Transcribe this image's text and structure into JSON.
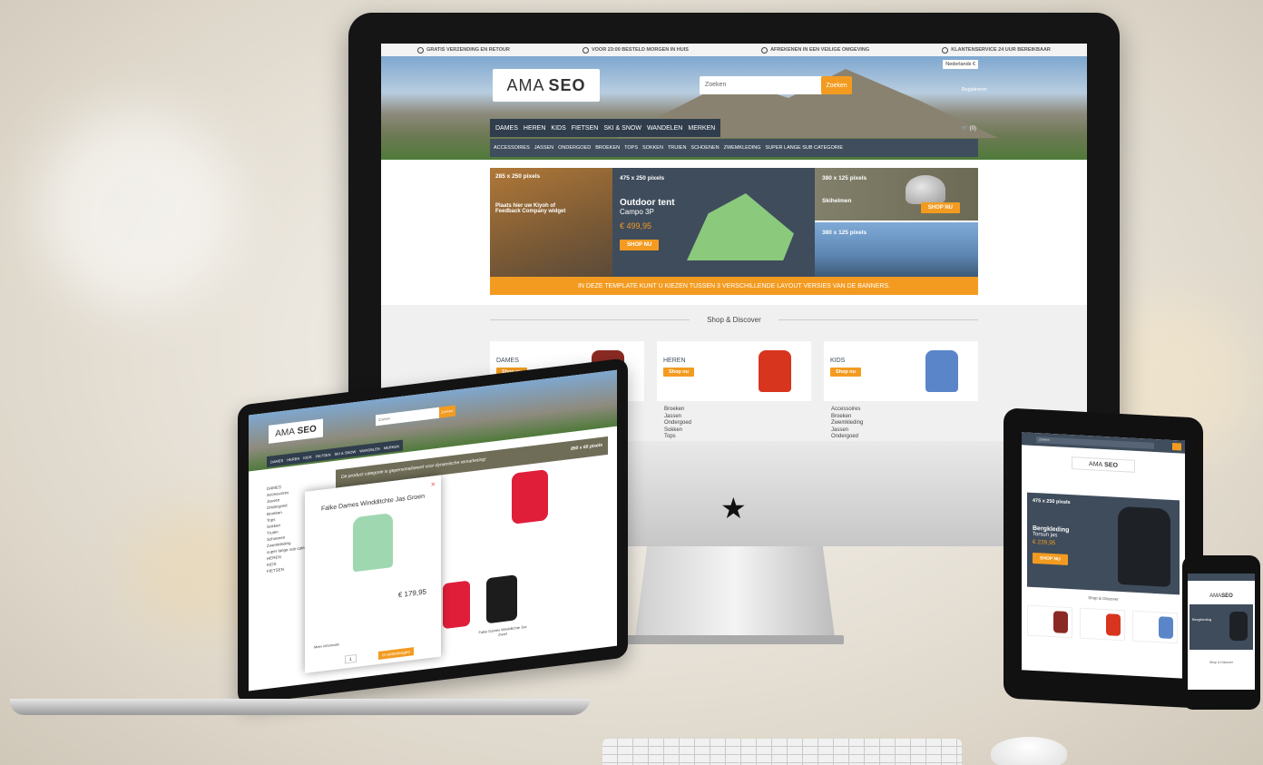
{
  "usp": [
    "GRATIS VERZENDING EN RETOUR",
    "VOOR 23:00 BESTELD MORGEN IN HUIS",
    "AFREKENEN IN EEN VEILIGE OMGEVING",
    "KLANTENSERVICE 24 UUR BEREIKBAAR"
  ],
  "header": {
    "logo_light": "AMA",
    "logo_bold": "SEO",
    "search_placeholder": "Zoeken",
    "search_button": "Zoeken",
    "language": "Nederlands",
    "currency": "€",
    "register": "Registreren",
    "cart": "(0)"
  },
  "nav_main": [
    "DAMES",
    "HEREN",
    "KIDS",
    "FIETSEN",
    "SKI & SNOW",
    "WANDELEN",
    "MERKEN"
  ],
  "nav_sub": [
    "ACCESSOIRES",
    "JASSEN",
    "ONDERGOED",
    "BROEKEN",
    "TOPS",
    "SOKKEN",
    "TRUIEN",
    "SCHOENEN",
    "ZWEMKLEDING",
    "SUPER LANGE SUB CATEGORIE"
  ],
  "banners": {
    "b1_size": "285 x 250 pixels",
    "b1_text": "Plaats hier uw Kiyoh of Feedback Company widget",
    "b2_size": "475 x 250 pixels",
    "b2_title": "Outdoor tent",
    "b2_subtitle": "Campo 3P",
    "b2_price": "€ 499,95",
    "b2_button": "SHOP NU",
    "b3_size": "380 x 125 pixels",
    "b3_label": "Skihelmen",
    "b3_button": "SHOP NU",
    "b4_size": "380 x 125 pixels",
    "strip": "IN DEZE TEMPLATE KUNT U KIEZEN TUSSEN 3 VERSCHILLENDE LAYOUT VERSIES VAN DE BANNERS."
  },
  "shop_discover": {
    "title": "Shop & Discover",
    "categories": [
      {
        "label": "DAMES",
        "button": "Shop nu",
        "color": "#8b2a24"
      },
      {
        "label": "HEREN",
        "button": "Shop nu",
        "color": "#d8351e"
      },
      {
        "label": "KIDS",
        "button": "Shop nu",
        "color": "#5a86c9"
      }
    ],
    "heren_links": [
      "Broeken",
      "Jassen",
      "Ondergoed",
      "Sokken",
      "Tops"
    ],
    "kids_links": [
      "Accessoires",
      "Broeken",
      "Zwemkleding",
      "Jassen",
      "Ondergoed"
    ]
  },
  "laptop": {
    "nav": [
      "DAMES",
      "HEREN",
      "KIDS",
      "FIETSEN",
      "SKI & SNOW",
      "WANDELEN",
      "MERKEN"
    ],
    "sidebar": [
      "DAMES",
      "Accessoires",
      "Jassen",
      "Ondergoed",
      "Broeken",
      "Tops",
      "Sokken",
      "Truien",
      "Schoenen",
      "Zwemkleding",
      "super lange sub categorie",
      "HEREN",
      "KIDS",
      "FIETSEN"
    ],
    "banner_text": "De product categorie is gepersonaliseerd voor dynamische remarketing!",
    "banner_size": "850 x 65 pixels",
    "modal_title": "Falke Dames Windditchte Jas Groen",
    "modal_price": "€ 179,95",
    "modal_more": "Meer informatie",
    "modal_qty": "1",
    "modal_cart": "In winkelwagen",
    "product_label": "Falke Dames Windditchte Jas Zwart"
  },
  "tablet": {
    "search": "Zoeken",
    "hero_size": "475 x 250 pixels",
    "hero_title": "Bergkleding",
    "hero_subtitle": "Torsun jas",
    "hero_price": "€ 239,95",
    "hero_button": "SHOP NU",
    "section_title": "Shop & Discover"
  },
  "phone": {
    "hero_title": "Bergkleding",
    "section_title": "Shop & Discover"
  },
  "device_logo": "★"
}
